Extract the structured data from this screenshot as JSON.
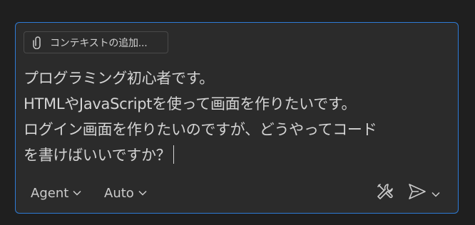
{
  "context_chip": {
    "icon": "paperclip-icon",
    "label": "コンテキストの追加..."
  },
  "prompt": {
    "lines": [
      "プログラミング初心者です。",
      "HTMLやJavaScriptを使って画面を作りたいです。",
      "ログイン画面を作りたいのですが、どうやってコード",
      "を書けばいいですか？"
    ]
  },
  "toolbar": {
    "mode_label": "Agent",
    "model_label": "Auto",
    "tools_icon": "tools-icon",
    "send_icon": "send-icon",
    "send_options_icon": "chevron-down-icon"
  },
  "colors": {
    "background": "#1f1f1f",
    "panel": "#2b2b2b",
    "focus_border": "#2e7bd6",
    "text": "#d4d4d4"
  }
}
